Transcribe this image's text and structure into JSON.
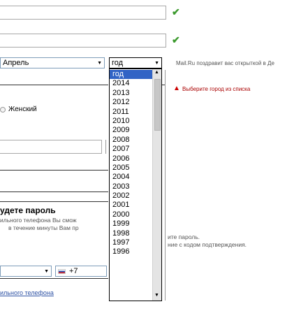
{
  "form": {
    "check1": "✔",
    "check2": "✔",
    "month_value": "Апрель",
    "year_select_value": "год",
    "greeting_text": "Mail.Ru поздравит вас открыткой в Де",
    "city_error": "Выберите город из списка",
    "gender_female": "Женский",
    "password_heading": "удете пароль",
    "phone_hint_line1": "ильного телефона Вы смож",
    "phone_hint_line2": "в течение минуты Вам пр",
    "phone_code": "+7",
    "password_hint_line1": "ите пароль.",
    "password_hint_line2": "ние с кодом подтверждения.",
    "phone_link": "ильного телефона"
  },
  "year_options": [
    "год",
    "2014",
    "2013",
    "2012",
    "2011",
    "2010",
    "2009",
    "2008",
    "2007",
    "2006",
    "2005",
    "2004",
    "2003",
    "2002",
    "2001",
    "2000",
    "1999",
    "1998",
    "1997",
    "1996"
  ],
  "year_selected_index": 0,
  "colors": {
    "check": "#3c9a2e",
    "selected": "#3163c5",
    "error": "#a00000",
    "link": "#2f53a5"
  },
  "icons": {
    "check": "check-icon",
    "warning": "warning-icon",
    "dropdown": "dropdown-arrow-icon",
    "flag": "russia-flag-icon"
  }
}
